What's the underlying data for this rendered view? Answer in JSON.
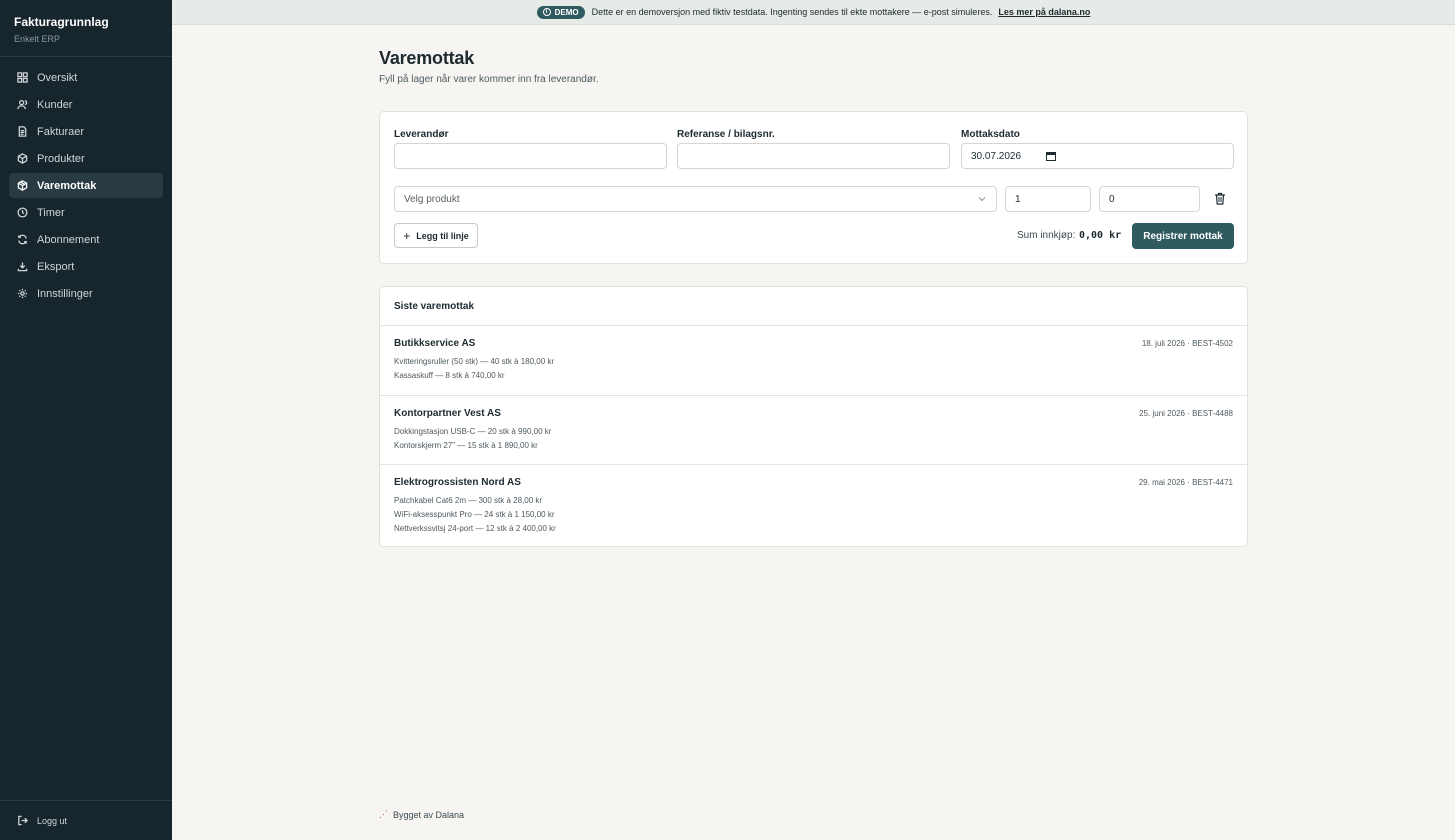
{
  "app": {
    "title": "Fakturagrunnlag",
    "subtitle": "Enkelt ERP"
  },
  "sidebar": {
    "items": [
      {
        "label": "Oversikt",
        "icon": "grid-icon"
      },
      {
        "label": "Kunder",
        "icon": "users-icon"
      },
      {
        "label": "Fakturaer",
        "icon": "document-icon"
      },
      {
        "label": "Produkter",
        "icon": "box-icon"
      },
      {
        "label": "Varemottak",
        "icon": "package-icon",
        "active": true
      },
      {
        "label": "Timer",
        "icon": "clock-icon"
      },
      {
        "label": "Abonnement",
        "icon": "refresh-icon"
      },
      {
        "label": "Eksport",
        "icon": "download-icon"
      },
      {
        "label": "Innstillinger",
        "icon": "gear-icon"
      }
    ],
    "logout_label": "Logg ut"
  },
  "banner": {
    "badge": "DEMO",
    "text": "Dette er en demoversjon med fiktiv testdata. Ingenting sendes til ekte mottakere — e-post simuleres.",
    "link": "Les mer på dalana.no"
  },
  "page": {
    "title": "Varemottak",
    "subtitle": "Fyll på lager når varer kommer inn fra leverandør."
  },
  "form": {
    "supplier_label": "Leverandør",
    "supplier_value": "",
    "reference_label": "Referanse / bilagsnr.",
    "reference_value": "",
    "date_label": "Mottaksdato",
    "date_value": "30.07.2026",
    "product_placeholder": "Velg produkt",
    "quantity_value": "1",
    "price_value": "0",
    "add_line_label": "Legg til linje",
    "sum_label": "Sum innkjøp:",
    "sum_value": "0,00 kr",
    "submit_label": "Registrer mottak"
  },
  "receipts": {
    "heading": "Siste varemottak",
    "items": [
      {
        "supplier": "Butikkservice AS",
        "meta": "18. juli 2026 · BEST-4502",
        "lines": [
          "Kvitteringsruller (50 stk) — 40 stk à 180,00 kr",
          "Kassaskuff — 8 stk à 740,00 kr"
        ]
      },
      {
        "supplier": "Kontorpartner Vest AS",
        "meta": "25. juni 2026 · BEST-4488",
        "lines": [
          "Dokkingstasjon USB-C — 20 stk à 990,00 kr",
          "Kontorskjerm 27\" — 15 stk à 1 890,00 kr"
        ]
      },
      {
        "supplier": "Elektrogrossisten Nord AS",
        "meta": "29. mai 2026 · BEST-4471",
        "lines": [
          "Patchkabel Cat6 2m — 300 stk à 28,00 kr",
          "WiFi-aksesspunkt Pro — 24 stk à 1 150,00 kr",
          "Nettverkssvitsj 24-port — 12 stk à 2 400,00 kr"
        ]
      }
    ]
  },
  "footer": {
    "text": "Bygget av Dalana"
  },
  "colors": {
    "sidebar": "#17252c",
    "accent": "#2f5a5f",
    "background": "#f6f5f1"
  }
}
